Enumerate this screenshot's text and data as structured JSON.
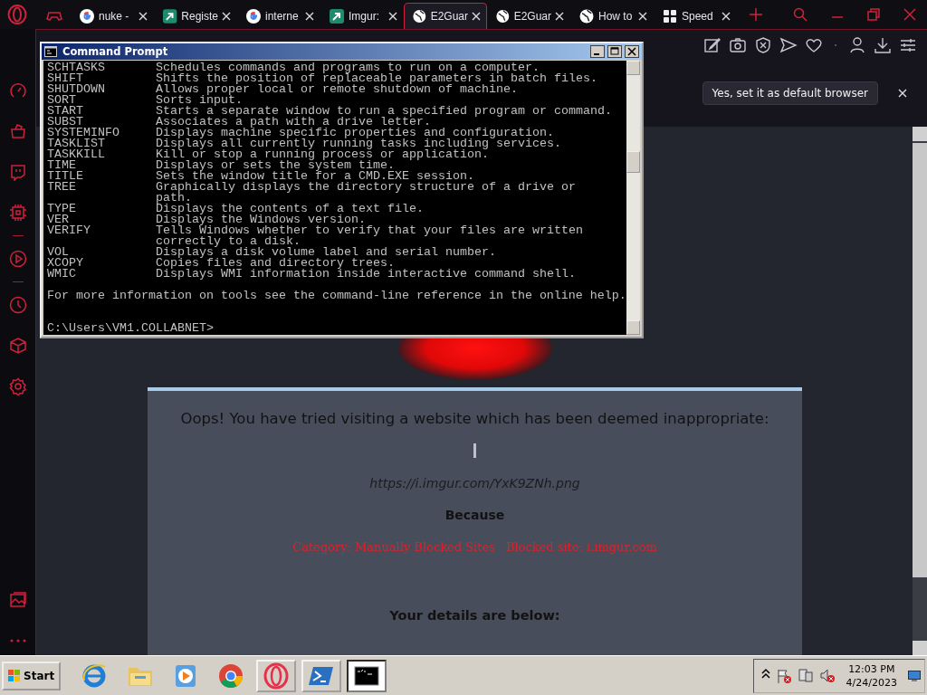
{
  "browser": {
    "tabs": [
      {
        "kind": "game",
        "selected": false
      },
      {
        "kind": "google",
        "label": "nuke -",
        "selected": false
      },
      {
        "kind": "bookmark",
        "label": "Registe",
        "selected": false
      },
      {
        "kind": "google",
        "label": "interne",
        "selected": false
      },
      {
        "kind": "bookmark",
        "label": "Imgur:",
        "selected": false
      },
      {
        "kind": "globe",
        "label": "E2Guar",
        "selected": true
      },
      {
        "kind": "globe",
        "label": "E2Guar",
        "selected": false
      },
      {
        "kind": "globe",
        "label": "How to",
        "selected": false
      },
      {
        "kind": "apps",
        "label": "Speed",
        "selected": false
      }
    ],
    "sidebar": [
      {
        "kind": "speed"
      },
      {
        "kind": "bag"
      },
      {
        "kind": "chat"
      },
      {
        "kind": "chip"
      },
      {
        "kind": "separator"
      },
      {
        "kind": "play"
      },
      {
        "kind": "separator"
      },
      {
        "kind": "clock"
      },
      {
        "kind": "cube"
      },
      {
        "kind": "gear"
      }
    ],
    "sidebar_bottom": [
      {
        "kind": "image"
      },
      {
        "kind": "more"
      }
    ],
    "toolbar": [
      {
        "kind": "edit"
      },
      {
        "kind": "camera"
      },
      {
        "kind": "shield"
      },
      {
        "kind": "send"
      },
      {
        "kind": "heart"
      },
      {
        "kind": "separator"
      },
      {
        "kind": "person"
      },
      {
        "kind": "download"
      },
      {
        "kind": "sliders"
      }
    ],
    "notification": {
      "button": "Yes, set it as default browser"
    }
  },
  "page": {
    "heading": "Oops! You have tried visiting a website which has been deemed inappropriate:",
    "url": "https://i.imgur.com/YxK9ZNh.png",
    "because": "Because",
    "reasons": [
      "Category: Manually Blocked Sites",
      "Blocked site: i.imgur.com"
    ],
    "details_heading": "Your details are below:"
  },
  "command_prompt": {
    "title": "Command Prompt",
    "entries": [
      {
        "command": "SCHTASKS",
        "description": [
          "Schedules commands and programs to run on a computer."
        ]
      },
      {
        "command": "SHIFT",
        "description": [
          "Shifts the position of replaceable parameters in batch files."
        ]
      },
      {
        "command": "SHUTDOWN",
        "description": [
          "Allows proper local or remote shutdown of machine."
        ]
      },
      {
        "command": "SORT",
        "description": [
          "Sorts input."
        ]
      },
      {
        "command": "START",
        "description": [
          "Starts a separate window to run a specified program or command."
        ]
      },
      {
        "command": "SUBST",
        "description": [
          "Associates a path with a drive letter."
        ]
      },
      {
        "command": "SYSTEMINFO",
        "description": [
          "Displays machine specific properties and configuration."
        ]
      },
      {
        "command": "TASKLIST",
        "description": [
          "Displays all currently running tasks including services."
        ]
      },
      {
        "command": "TASKKILL",
        "description": [
          "Kill or stop a running process or application."
        ]
      },
      {
        "command": "TIME",
        "description": [
          "Displays or sets the system time."
        ]
      },
      {
        "command": "TITLE",
        "description": [
          "Sets the window title for a CMD.EXE session."
        ]
      },
      {
        "command": "TREE",
        "description": [
          "Graphically displays the directory structure of a drive or",
          "path."
        ]
      },
      {
        "command": "TYPE",
        "description": [
          "Displays the contents of a text file."
        ]
      },
      {
        "command": "VER",
        "description": [
          "Displays the Windows version."
        ]
      },
      {
        "command": "VERIFY",
        "description": [
          "Tells Windows whether to verify that your files are written",
          "correctly to a disk."
        ]
      },
      {
        "command": "VOL",
        "description": [
          "Displays a disk volume label and serial number."
        ]
      },
      {
        "command": "XCOPY",
        "description": [
          "Copies files and directory trees."
        ]
      },
      {
        "command": "WMIC",
        "description": [
          "Displays WMI information inside interactive command shell."
        ]
      }
    ],
    "footer": "For more information on tools see the command-line reference in the online help.",
    "prompt": "C:\\Users\\VM1.COLLABNET>"
  },
  "taskbar": {
    "start": "Start",
    "apps": [
      {
        "kind": "ie",
        "running": false,
        "selected": false
      },
      {
        "kind": "folder",
        "running": false,
        "selected": false
      },
      {
        "kind": "media",
        "running": false,
        "selected": false
      },
      {
        "kind": "chrome",
        "running": false,
        "selected": false
      },
      {
        "kind": "opera",
        "running": true,
        "selected": false
      },
      {
        "kind": "powershell",
        "running": true,
        "selected": false
      },
      {
        "kind": "cmd",
        "running": true,
        "selected": true
      }
    ],
    "tray": [
      {
        "kind": "chevron"
      },
      {
        "kind": "flag"
      },
      {
        "kind": "network"
      },
      {
        "kind": "speaker"
      }
    ],
    "time": "12:03 PM",
    "date": "4/24/2023"
  }
}
